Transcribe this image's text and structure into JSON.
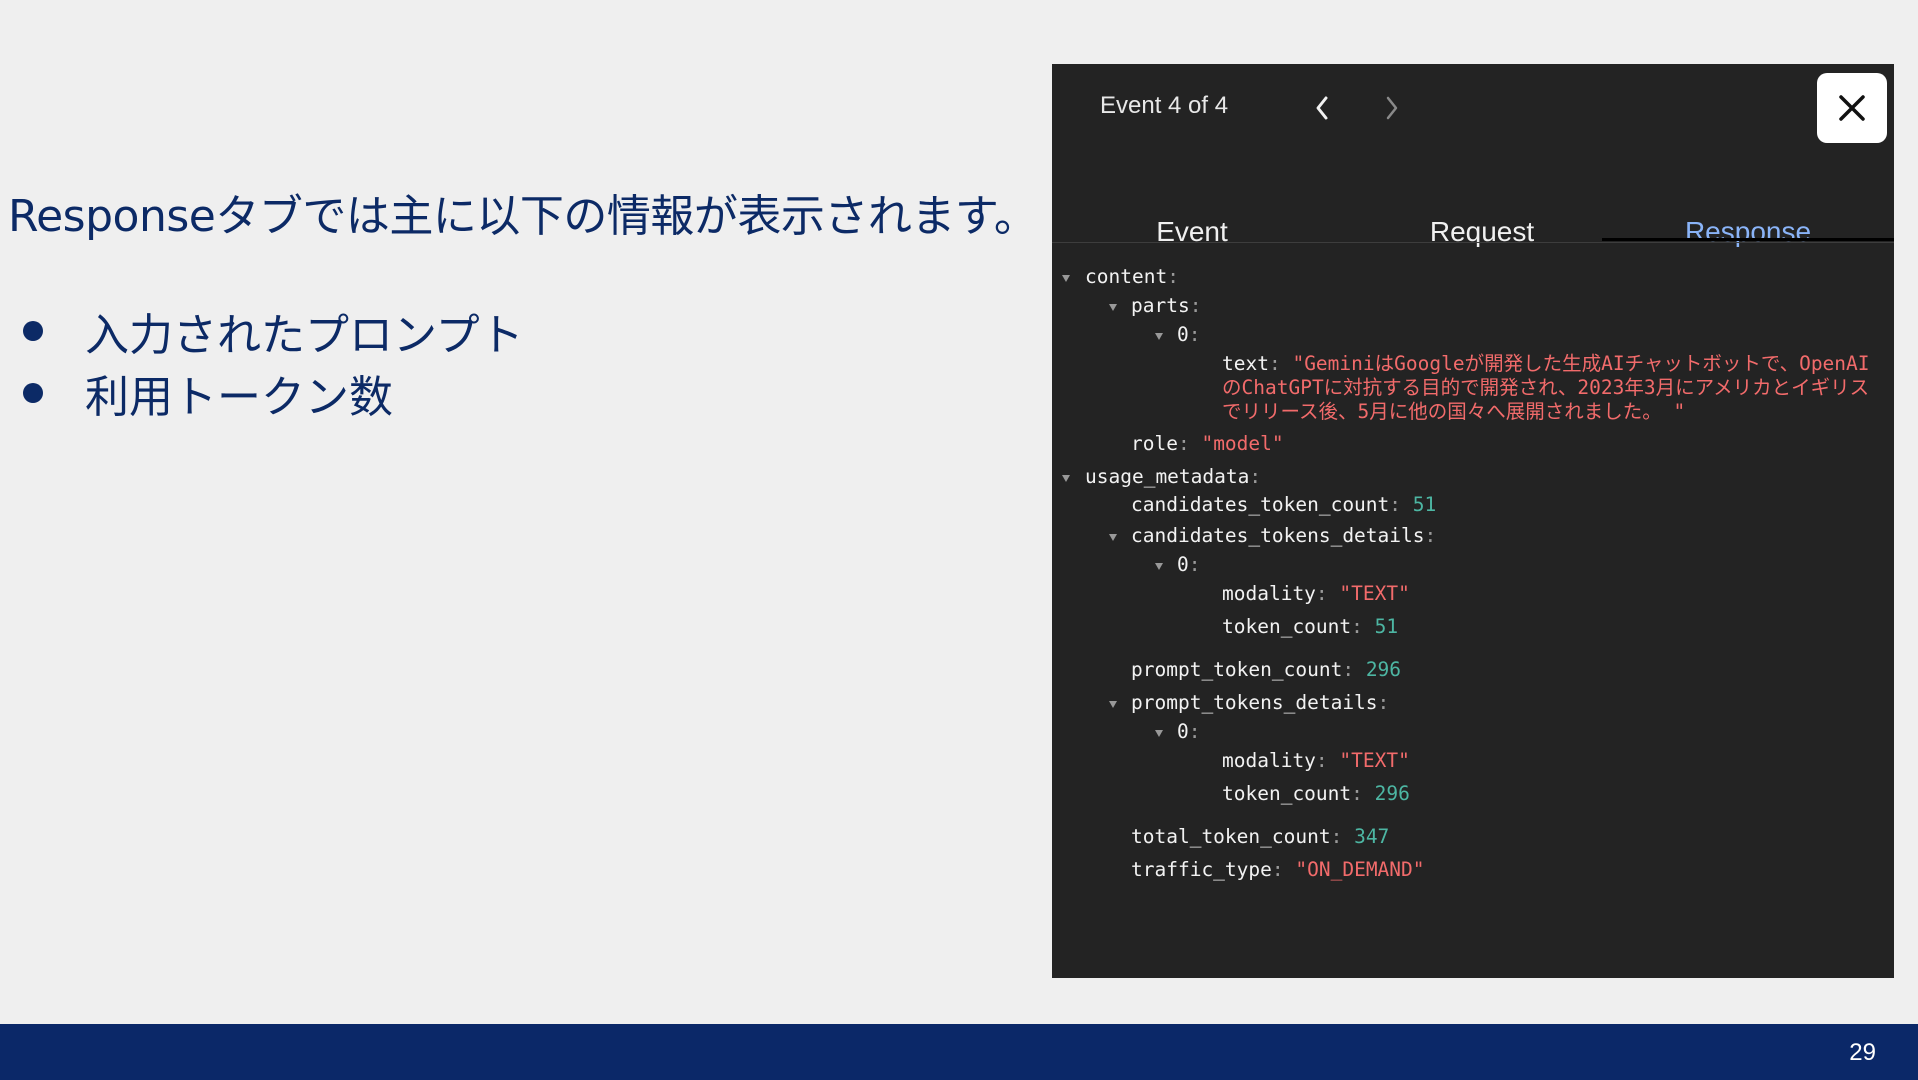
{
  "slide": {
    "heading": "Responseタブでは主に以下の情報が表示されます。",
    "bullets": [
      "入力されたプロンプト",
      "利用トークン数"
    ],
    "page_number": "29"
  },
  "panel": {
    "event_counter": "Event 4 of 4",
    "tabs": [
      {
        "label": "Event",
        "active": false
      },
      {
        "label": "Request",
        "active": false
      },
      {
        "label": "Response",
        "active": true
      }
    ],
    "colors": {
      "active_tab": "#8ab4f8",
      "string": "#f26b6b",
      "number": "#4db6a3",
      "background": "#232323"
    },
    "json": {
      "content_key": "content",
      "parts_key": "parts",
      "index_0": "0",
      "text_key": "text",
      "text_value": "\"GeminiはGoogleが開発した生成AIチャットボットで、OpenAIのChatGPTに対抗する目的で開発され、2023年3月にアメリカとイギリスでリリース後、5月に他の国々へ展開されました。 \"",
      "role_key": "role",
      "role_value": "\"model\"",
      "usage_key": "usage_metadata",
      "candidates_token_count_key": "candidates_token_count",
      "candidates_token_count": "51",
      "candidates_tokens_details_key": "candidates_tokens_details",
      "modality_key": "modality",
      "modality_value": "\"TEXT\"",
      "token_count_key": "token_count",
      "candidates_detail_token_count": "51",
      "prompt_token_count_key": "prompt_token_count",
      "prompt_token_count": "296",
      "prompt_tokens_details_key": "prompt_tokens_details",
      "prompt_detail_token_count": "296",
      "total_token_count_key": "total_token_count",
      "total_token_count": "347",
      "traffic_type_key": "traffic_type",
      "traffic_type_value": "\"ON_DEMAND\""
    }
  }
}
